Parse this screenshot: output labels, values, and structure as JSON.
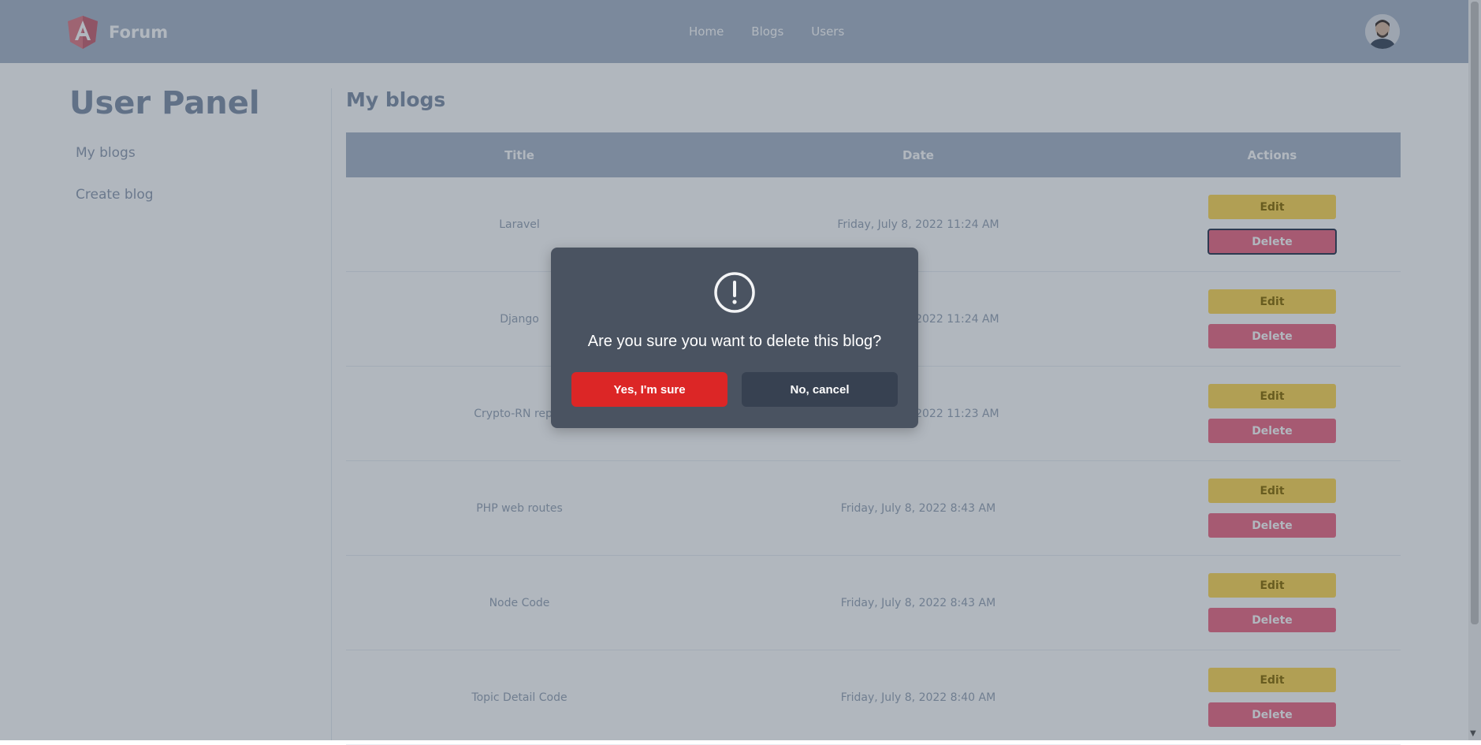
{
  "navbar": {
    "brand": "Forum",
    "links": [
      "Home",
      "Blogs",
      "Users"
    ],
    "avatar_icon": "user-avatar"
  },
  "sidebar": {
    "title": "User Panel",
    "items": [
      "My blogs",
      "Create blog"
    ]
  },
  "main": {
    "title": "My blogs",
    "headers": {
      "title": "Title",
      "date": "Date",
      "actions": "Actions"
    },
    "rows": [
      {
        "title": "Laravel",
        "date": "Friday, July 8, 2022 11:24 AM"
      },
      {
        "title": "Django",
        "date": "Friday, July 8, 2022 11:24 AM"
      },
      {
        "title": "Crypto-RN repos",
        "date": "Friday, July 8, 2022 11:23 AM"
      },
      {
        "title": "PHP web routes",
        "date": "Friday, July 8, 2022 8:43 AM"
      },
      {
        "title": "Node Code",
        "date": "Friday, July 8, 2022 8:43 AM"
      },
      {
        "title": "Topic Detail Code",
        "date": "Friday, July 8, 2022 8:40 AM"
      }
    ],
    "edit_label": "Edit",
    "delete_label": "Delete"
  },
  "modal": {
    "icon": "exclamation-circle-icon",
    "message": "Are you sure you want to delete this blog?",
    "confirm_label": "Yes, I'm sure",
    "cancel_label": "No, cancel"
  },
  "colors": {
    "navbar": "#a9b5c8",
    "edit_button": "#ffd954",
    "delete_button": "#ee6a85",
    "modal_background": "#4a5361",
    "confirm_button": "#dc2626",
    "cancel_button": "#374151"
  }
}
